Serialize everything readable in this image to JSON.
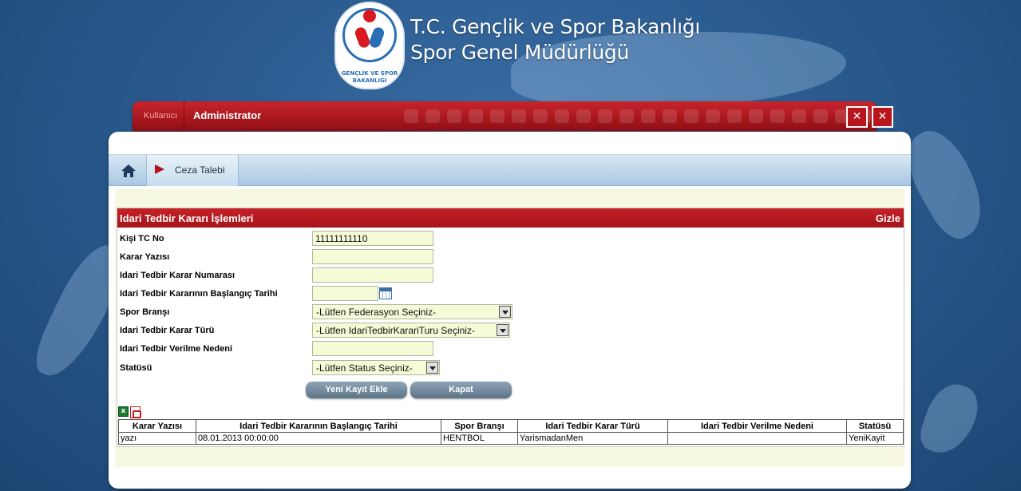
{
  "header": {
    "ministry_line1": "T.C. Gençlik ve Spor Bakanlığı",
    "ministry_line2": "Spor Genel Müdürlüğü",
    "emblem_text_top": "GENÇLİK VE SPOR",
    "emblem_text_bottom": "BAKANLIĞI"
  },
  "userbar": {
    "user_label": "Kullanıcı",
    "user_name": "Administrator",
    "close_label": "✕",
    "exit_label": "✕"
  },
  "nav": {
    "home_icon": "home-icon",
    "tab_label": "Ceza Talebi"
  },
  "section": {
    "title": "Idari Tedbir Kararı İşlemleri",
    "hide_label": "Gizle"
  },
  "form": {
    "kisi_tc_label": "Kişi TC No",
    "kisi_tc_value": "11111111110",
    "karar_yazisi_label": "Karar Yazısı",
    "karar_yazisi_value": "",
    "karar_no_label": "Idari Tedbir Karar Numarası",
    "karar_no_value": "",
    "baslangic_label": "Idari Tedbir Kararının Başlangıç Tarihi",
    "baslangic_value": "",
    "brans_label": "Spor Branşı",
    "brans_value": "-Lütfen Federasyon Seçiniz-",
    "karar_turu_label": "Idari Tedbir Karar Türü",
    "karar_turu_value": "-Lütfen IdariTedbirKarariTuru Seçiniz-",
    "neden_label": "Idari Tedbir Verilme Nedeni",
    "neden_value": "",
    "status_label": "Statüsü",
    "status_value": "-Lütfen Status Seçiniz-"
  },
  "buttons": {
    "new_record": "Yeni Kayıt Ekle",
    "close": "Kapat"
  },
  "export": {
    "excel_icon": "excel-icon",
    "pdf_icon": "pdf-icon",
    "excel_glyph": "x"
  },
  "table": {
    "headers": [
      "Karar Yazısı",
      "Idari Tedbir Kararının Başlangıç Tarihi",
      "Spor Branşı",
      "Idari Tedbir Karar Türü",
      "Idari Tedbir Verilme Nedeni",
      "Statüsü"
    ],
    "rows": [
      [
        "yazı",
        "08.01.2013 00:00:00",
        "HENTBOL",
        "YarismadanMen",
        "",
        "YeniKayit"
      ]
    ]
  },
  "colors": {
    "brand_red": "#c52127",
    "background_blue": "#2a5a8e",
    "input_bg": "#f5fbd6"
  }
}
